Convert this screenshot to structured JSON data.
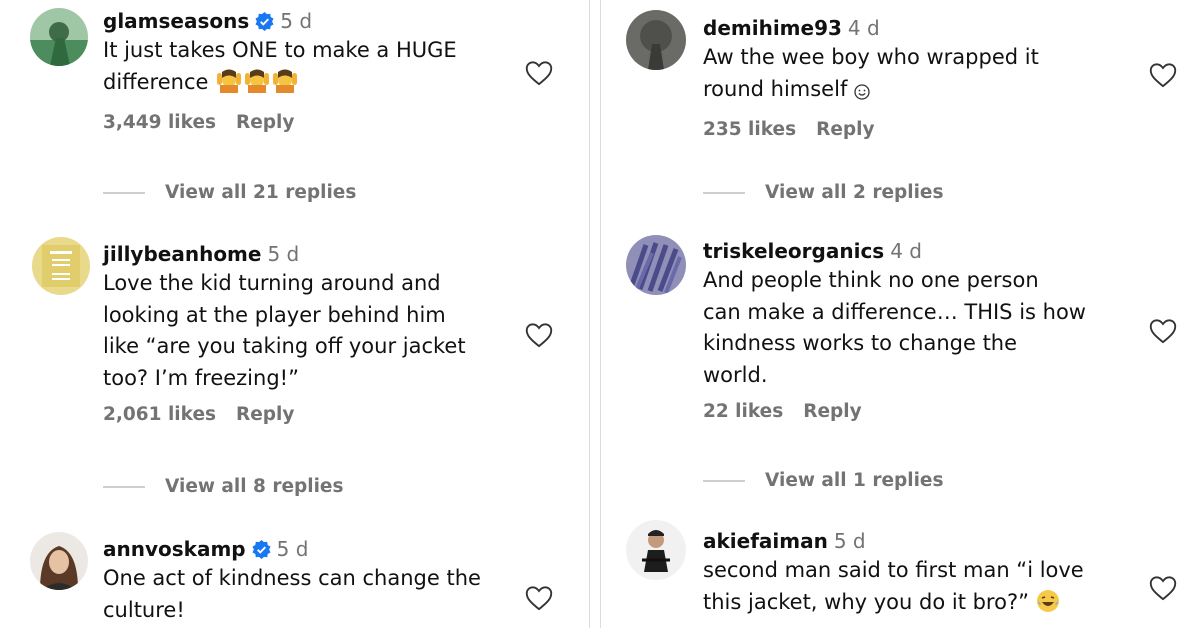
{
  "left_comments": [
    {
      "username": "glamseasons",
      "verified": true,
      "time": "5 d",
      "text_lines": [
        "It just takes ONE to make a HUGE",
        "difference"
      ],
      "emoji": [
        "person-raising-hands",
        "person-raising-hands",
        "person-raising-hands"
      ],
      "likes": "3,449 likes",
      "reply": "Reply",
      "view_replies": "View all 21 replies"
    },
    {
      "username": "jillybeanhome",
      "verified": false,
      "time": "5 d",
      "text_lines": [
        "Love the kid turning around and",
        "looking at the player behind him",
        "like “are you taking off your jacket",
        "too? I’m freezing!”"
      ],
      "likes": "2,061 likes",
      "reply": "Reply",
      "view_replies": "View all 8 replies"
    },
    {
      "username": "annvoskamp",
      "verified": true,
      "time": "5 d",
      "text_lines": [
        "One act of kindness can change the",
        "culture!"
      ]
    }
  ],
  "right_comments": [
    {
      "username": "demihime93",
      "time": "4 d",
      "text_lines": [
        "Aw the wee boy who wrapped it",
        "round himself"
      ],
      "emoji": [
        "smiling-face"
      ],
      "likes": "235 likes",
      "reply": "Reply",
      "view_replies": "View all 2 replies"
    },
    {
      "username": "triskeleorganics",
      "time": "4 d",
      "text_lines": [
        "And people think no one person",
        "can make a difference… THIS is how",
        "kindness works to change the",
        "world."
      ],
      "likes": "22 likes",
      "reply": "Reply",
      "view_replies": "View all 1 replies"
    },
    {
      "username": "akiefaiman",
      "time": "5 d",
      "text_lines": [
        "second man said to first man “i love",
        "this jacket, why you do it bro?”"
      ],
      "emoji": [
        "laughing-face"
      ]
    }
  ],
  "colors": {
    "verified_blue": "#1877F2",
    "secondary_text": "#737373",
    "divider": "#cfcfcf"
  }
}
